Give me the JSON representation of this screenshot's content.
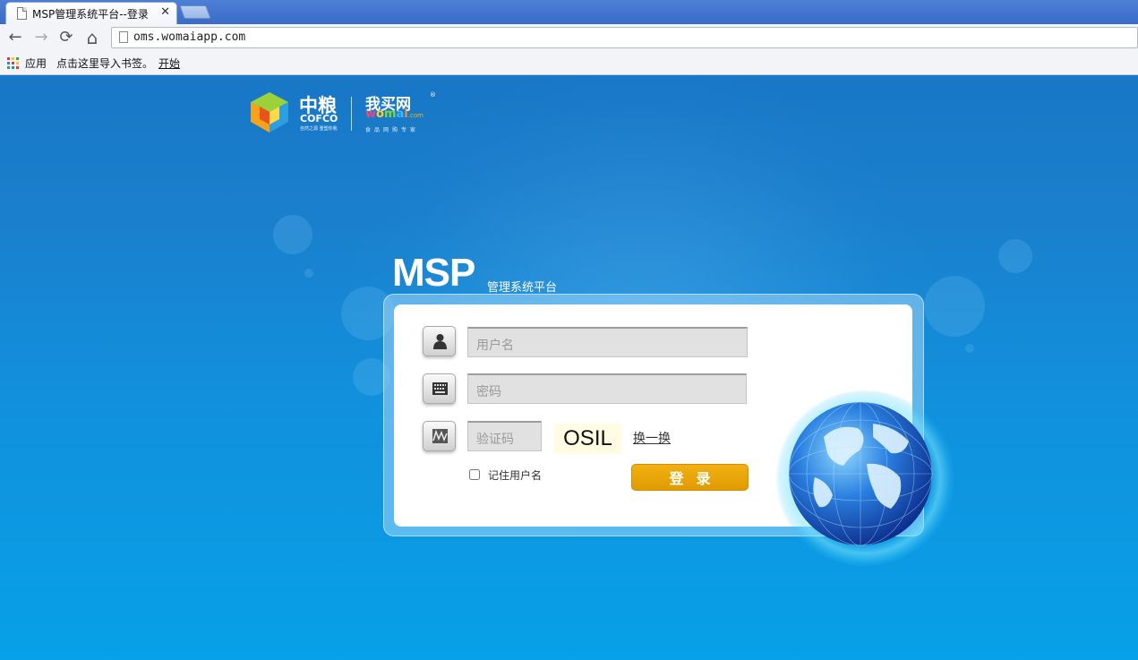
{
  "browser": {
    "tab_title": "MSP管理系统平台--登录",
    "tab_close": "✕",
    "url": "oms.womaiapp.com",
    "nav": {
      "back": "←",
      "forward": "→",
      "reload": "⟳",
      "home": "⌂"
    },
    "bookmarks": {
      "apps_label": "应用",
      "import_text": "点击这里导入书签。",
      "start_link": "开始"
    }
  },
  "logo": {
    "cofco_cn": "中粮",
    "cofco_en": "COFCO",
    "cofco_slogan": "自然之源 重塑你我",
    "womai_cn": "我买网",
    "womai_en": [
      "w",
      "o",
      "m",
      "a",
      "i"
    ],
    "womai_dotcom": ".com",
    "womai_reg": "®",
    "womai_slogan": "食品网购专家"
  },
  "login": {
    "brand": "MSP",
    "subtitle": "管理系统平台",
    "username_placeholder": "用户名",
    "password_placeholder": "密码",
    "captcha_placeholder": "验证码",
    "captcha_text": "OSIL",
    "refresh_label": "换一换",
    "remember_label": "记住用户名",
    "remember_checked": false,
    "submit_label": "登录"
  },
  "colors": {
    "accent_button": "#e8a400",
    "page_top": "#1877c6",
    "page_bottom": "#06a1e8",
    "captcha_bg": "#fffce3"
  }
}
